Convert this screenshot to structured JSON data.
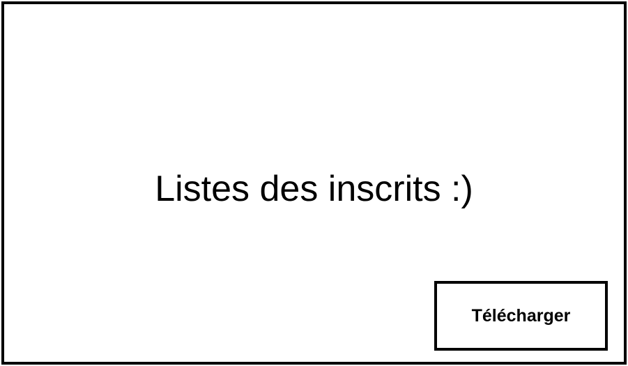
{
  "page": {
    "title": "Listes des inscrits :)"
  },
  "actions": {
    "download_label": "Télécharger"
  }
}
